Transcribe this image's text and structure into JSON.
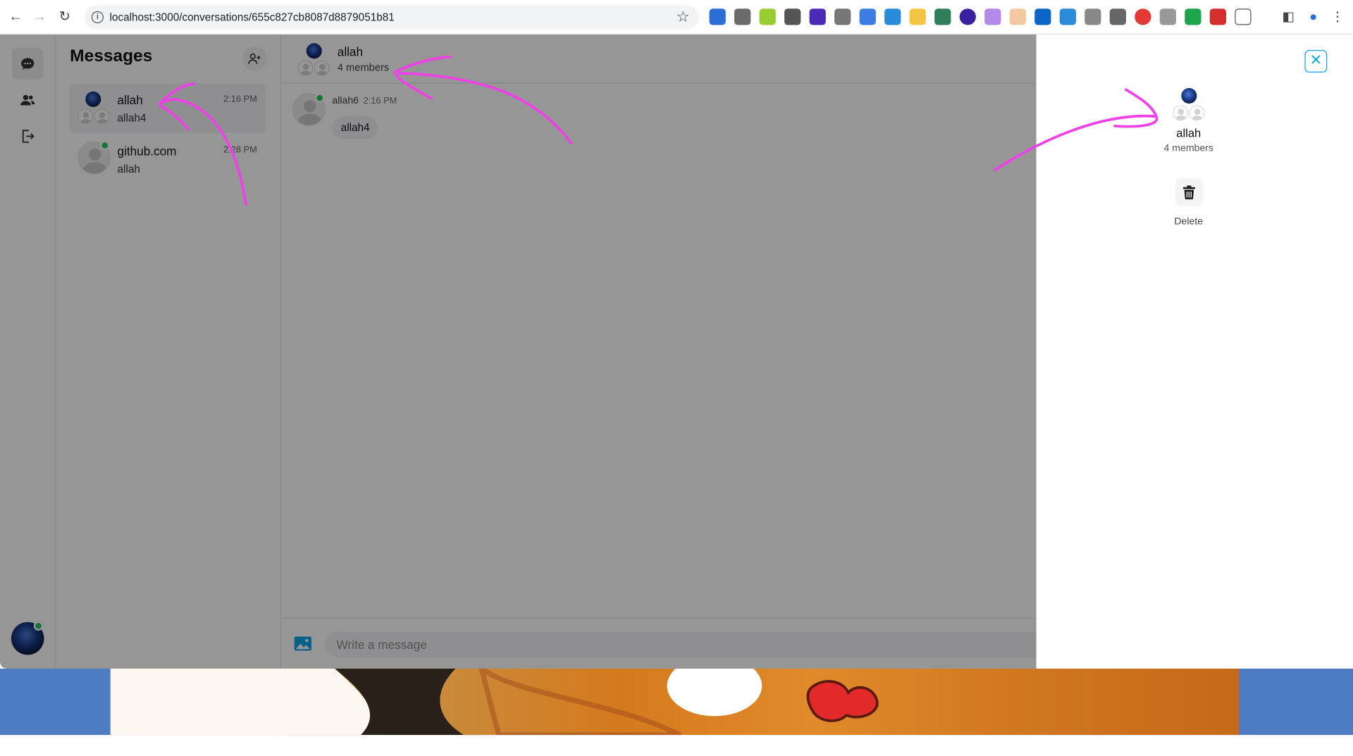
{
  "browser": {
    "url": "localhost:3000/conversations/655c827cb8087d8879051b81"
  },
  "sidebar": {
    "icons": [
      "chat-bubble-icon",
      "users-icon",
      "logout-icon"
    ]
  },
  "list": {
    "title": "Messages",
    "conversations": [
      {
        "name": "allah",
        "last": "allah4",
        "time": "2:16 PM"
      },
      {
        "name": "github.com",
        "last": "allah",
        "time": "2:28 PM"
      }
    ]
  },
  "chat": {
    "title": "allah",
    "subtitle": "4 members",
    "messages": [
      {
        "sender": "allah6",
        "time": "2:16 PM",
        "text": "allah4"
      }
    ],
    "composer_placeholder": "Write a message"
  },
  "panel": {
    "title": "allah",
    "subtitle": "4 members",
    "delete_label": "Delete"
  },
  "colors": {
    "online": "#22c55e",
    "accent": "#0ea5e9",
    "annotation": "#f040e8"
  }
}
